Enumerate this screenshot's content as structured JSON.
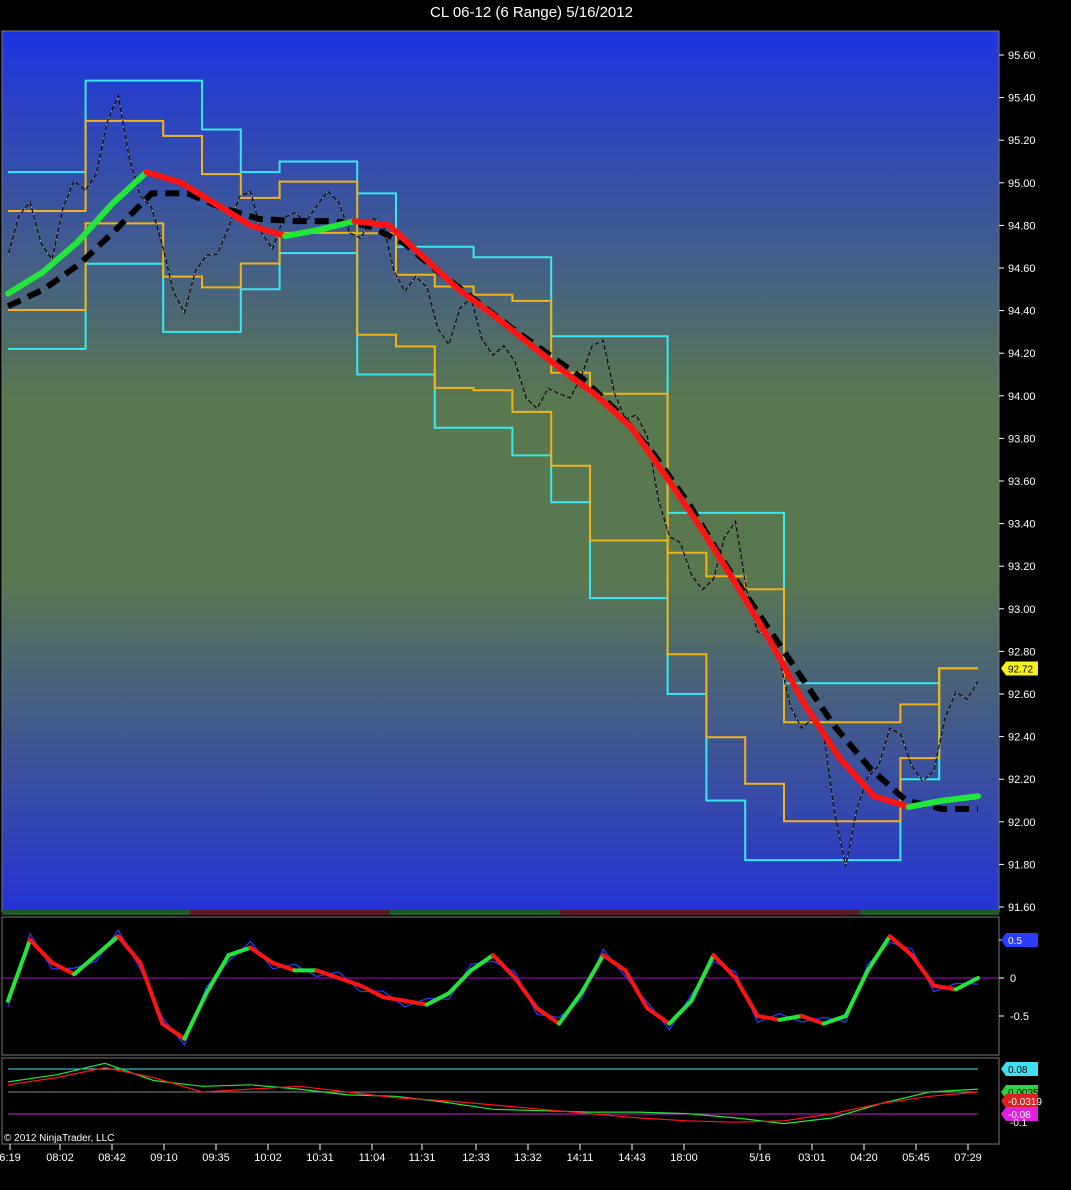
{
  "window": {
    "title": "CL 06-12 (6 Range)  5/16/2012"
  },
  "copyright": "© 2012 NinjaTrader, LLC",
  "colors": {
    "bg_top": "#1e34e2",
    "bg_mid": "#5a7850",
    "bg_bottom": "#2433d6",
    "cyan": "#38e8f0",
    "orange": "#f2b21a",
    "green": "#22e63a",
    "red": "#ff1414",
    "black": "#000000",
    "white": "#ffffff",
    "purple": "#b000d0",
    "label_yellow": "#f5f01e"
  },
  "chart_data": [
    {
      "type": "line",
      "panel": "price",
      "title": "CL 06-12 (6 Range)  5/16/2012",
      "ylim": [
        91.56,
        95.72
      ],
      "y_ticks": [
        95.6,
        95.4,
        95.2,
        95.0,
        94.8,
        94.6,
        94.4,
        94.2,
        94.0,
        93.8,
        93.6,
        93.4,
        93.2,
        93.0,
        92.8,
        92.6,
        92.4,
        92.2,
        92.0,
        91.8,
        91.6
      ],
      "y_tick_labels": [
        "95.60",
        "95.40",
        "95.20",
        "95.00",
        "94.80",
        "94.60",
        "94.40",
        "94.20",
        "94.00",
        "93.80",
        "93.60",
        "93.40",
        "93.20",
        "93.00",
        "92.80",
        "92.60",
        "92.40",
        "92.20",
        "92.00",
        "91.80",
        "91.60"
      ],
      "last_price_label": "92.72",
      "last_price": 92.72,
      "x_categories": [
        "6:19",
        "08:02",
        "08:42",
        "09:10",
        "09:35",
        "10:02",
        "10:31",
        "11:04",
        "11:31",
        "12:33",
        "13:32",
        "14:11",
        "14:43",
        "18:00",
        "5/16",
        "03:01",
        "04:20",
        "05:45",
        "07:29"
      ],
      "series": [
        {
          "role": "price",
          "values": [
            94.72,
            94.85,
            94.7,
            94.95,
            95.1,
            95.35,
            95.0,
            94.65,
            94.45,
            94.6,
            94.85,
            94.9,
            94.75,
            94.8,
            94.95,
            94.85,
            94.8,
            94.75,
            94.55,
            94.45,
            94.3,
            94.4,
            94.25,
            94.1,
            94.0,
            93.95,
            94.15,
            94.2,
            93.95,
            93.75,
            93.4,
            93.1,
            93.2,
            93.35,
            92.95,
            92.7,
            92.5,
            92.35,
            91.85,
            92.15,
            92.5,
            92.2,
            92.3,
            92.55,
            92.72
          ]
        },
        {
          "role": "upper-channel",
          "values": [
            95.05,
            95.05,
            95.48,
            95.48,
            95.48,
            95.25,
            95.05,
            95.1,
            95.1,
            94.95,
            94.7,
            94.7,
            94.65,
            94.65,
            94.28,
            94.28,
            94.28,
            93.45,
            93.45,
            93.45,
            92.65,
            92.65,
            92.65,
            92.65,
            92.72
          ]
        },
        {
          "role": "lower-channel",
          "values": [
            94.22,
            94.22,
            94.62,
            94.62,
            94.3,
            94.3,
            94.5,
            94.67,
            94.67,
            94.1,
            94.1,
            93.85,
            93.85,
            93.72,
            93.5,
            93.05,
            93.05,
            92.6,
            92.1,
            91.82,
            91.82,
            91.82,
            91.82,
            92.2,
            92.72
          ]
        },
        {
          "role": "trend-ma",
          "values": [
            94.48,
            94.58,
            94.72,
            94.9,
            95.05,
            95.0,
            94.9,
            94.8,
            94.75,
            94.78,
            94.82,
            94.8,
            94.65,
            94.5,
            94.38,
            94.25,
            94.12,
            94.0,
            93.85,
            93.62,
            93.38,
            93.12,
            92.85,
            92.55,
            92.3,
            92.12,
            92.07,
            92.1,
            92.12
          ]
        },
        {
          "role": "slow-ma",
          "values": [
            94.42,
            94.5,
            94.62,
            94.78,
            94.95,
            94.95,
            94.88,
            94.83,
            94.82,
            94.82,
            94.8,
            94.72,
            94.58,
            94.45,
            94.32,
            94.2,
            94.08,
            93.92,
            93.72,
            93.48,
            93.2,
            92.95,
            92.7,
            92.45,
            92.25,
            92.1,
            92.06,
            92.06
          ]
        }
      ]
    },
    {
      "type": "line",
      "panel": "oscillator",
      "ylim": [
        -0.8,
        0.75
      ],
      "y_ticks": [
        0.5,
        0,
        -0.5
      ],
      "y_tick_labels": [
        "0.5",
        "0",
        "-0.5"
      ],
      "last_value_label": "0.5",
      "series": [
        {
          "role": "oscillator-main",
          "values": [
            -0.3,
            0.5,
            0.2,
            0.05,
            0.3,
            0.55,
            0.2,
            -0.6,
            -0.8,
            -0.2,
            0.3,
            0.4,
            0.2,
            0.1,
            0.1,
            0.0,
            -0.1,
            -0.25,
            -0.3,
            -0.35,
            -0.2,
            0.1,
            0.3,
            0.0,
            -0.4,
            -0.6,
            -0.2,
            0.3,
            0.1,
            -0.4,
            -0.6,
            -0.3,
            0.3,
            0.0,
            -0.5,
            -0.55,
            -0.5,
            -0.6,
            -0.5,
            0.1,
            0.55,
            0.3,
            -0.1,
            -0.15,
            0.0
          ]
        }
      ]
    },
    {
      "type": "line",
      "panel": "momentum",
      "reference_labels": [
        "0.08",
        "0.00354",
        "-0.0319",
        "-0.08",
        "-0.1"
      ],
      "series": [
        {
          "role": "momentum-green",
          "values": [
            0.07,
            0.12,
            0.2,
            0.08,
            0.04,
            0.05,
            0.02,
            -0.02,
            -0.03,
            -0.07,
            -0.12,
            -0.13,
            -0.14,
            -0.14,
            -0.15,
            -0.18,
            -0.22,
            -0.18,
            -0.08,
            0.0,
            0.02
          ]
        },
        {
          "role": "momentum-red",
          "values": [
            0.05,
            0.1,
            0.17,
            0.1,
            0.0,
            0.02,
            0.04,
            0.0,
            -0.04,
            -0.06,
            -0.09,
            -0.12,
            -0.15,
            -0.18,
            -0.2,
            -0.21,
            -0.2,
            -0.15,
            -0.08,
            -0.03,
            0.0
          ]
        }
      ]
    }
  ]
}
